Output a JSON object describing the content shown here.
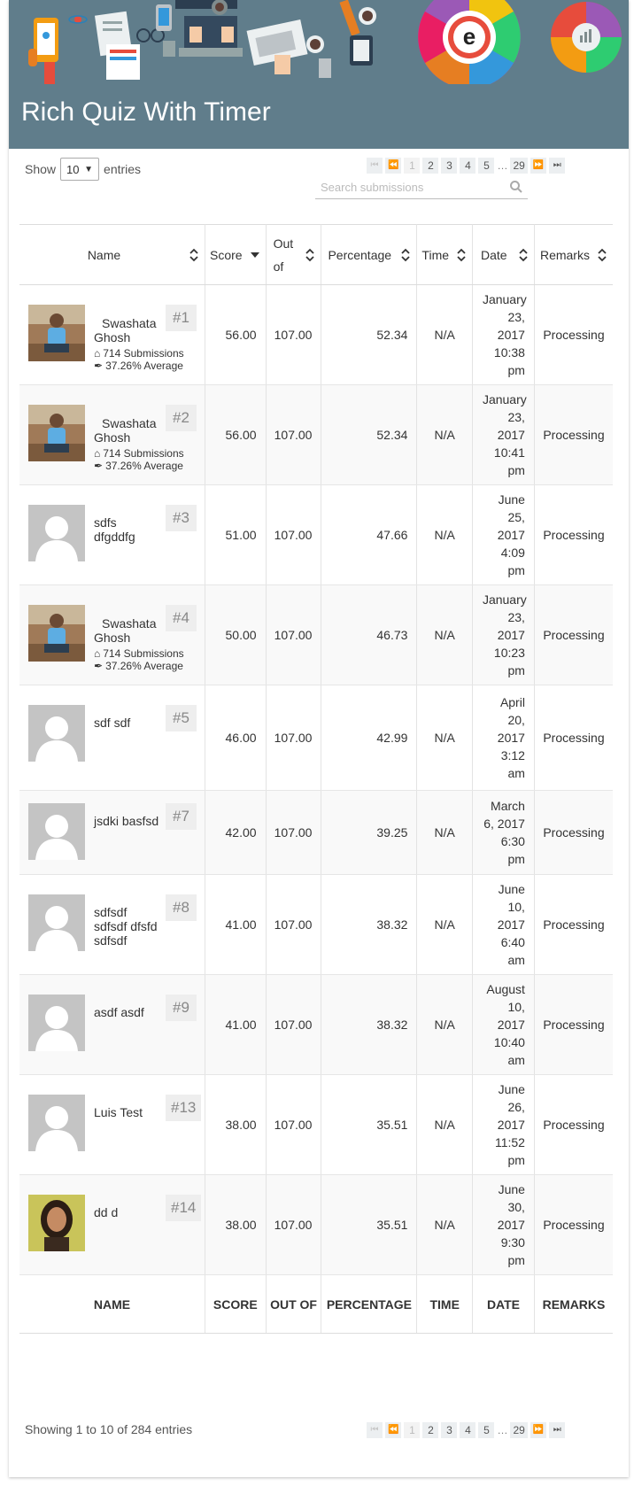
{
  "header": {
    "title": "Rich Quiz With Timer"
  },
  "length": {
    "prefix": "Show",
    "value": "10",
    "suffix": "entries"
  },
  "search": {
    "placeholder": "Search submissions"
  },
  "pagination": {
    "first": "⏮",
    "prev": "⏪",
    "pages": [
      "1",
      "2",
      "3",
      "4",
      "5"
    ],
    "ellipsis": "…",
    "last_page": "29",
    "next": "⏩",
    "last": "⏭",
    "current": "1"
  },
  "columns": {
    "name": "Name",
    "score": "Score",
    "out_of": "Out of",
    "percentage": "Percentage",
    "time": "Time",
    "date": "Date",
    "remarks": "Remarks"
  },
  "footer_columns": {
    "name": "NAME",
    "score": "SCORE",
    "out_of": "OUT OF",
    "percentage": "PERCENTAGE",
    "time": "TIME",
    "date": "DATE",
    "remarks": "REMARKS"
  },
  "rows": [
    {
      "avatar": "photo-man",
      "name": "Swashata Ghosh",
      "rank": "#1",
      "submissions": "714 Submissions",
      "average": "37.26% Average",
      "score": "56.00",
      "out_of": "107.00",
      "percentage": "52.34",
      "time": "N/A",
      "date": "January 23, 2017 10:38 pm",
      "remarks": "Processing"
    },
    {
      "avatar": "photo-man",
      "name": "Swashata Ghosh",
      "rank": "#2",
      "submissions": "714 Submissions",
      "average": "37.26% Average",
      "score": "56.00",
      "out_of": "107.00",
      "percentage": "52.34",
      "time": "N/A",
      "date": "January 23, 2017 10:41 pm",
      "remarks": "Processing"
    },
    {
      "avatar": "placeholder",
      "name": "sdfs dfgddfg",
      "rank": "#3",
      "score": "51.00",
      "out_of": "107.00",
      "percentage": "47.66",
      "time": "N/A",
      "date": "June 25, 2017 4:09 pm",
      "remarks": "Processing"
    },
    {
      "avatar": "photo-man",
      "name": "Swashata Ghosh",
      "rank": "#4",
      "submissions": "714 Submissions",
      "average": "37.26% Average",
      "score": "50.00",
      "out_of": "107.00",
      "percentage": "46.73",
      "time": "N/A",
      "date": "January 23, 2017 10:23 pm",
      "remarks": "Processing"
    },
    {
      "avatar": "placeholder",
      "name": "sdf sdf",
      "rank": "#5",
      "score": "46.00",
      "out_of": "107.00",
      "percentage": "42.99",
      "time": "N/A",
      "date": "April 20, 2017 3:12 am",
      "remarks": "Processing"
    },
    {
      "avatar": "placeholder",
      "name": "jsdki basfsd",
      "rank": "#7",
      "score": "42.00",
      "out_of": "107.00",
      "percentage": "39.25",
      "time": "N/A",
      "date": "March 6, 2017 6:30 pm",
      "remarks": "Processing"
    },
    {
      "avatar": "placeholder",
      "name": "sdfsdf sdfsdf dfsfd sdfsdf",
      "rank": "#8",
      "score": "41.00",
      "out_of": "107.00",
      "percentage": "38.32",
      "time": "N/A",
      "date": "June 10, 2017 6:40 am",
      "remarks": "Processing"
    },
    {
      "avatar": "placeholder",
      "name": "asdf asdf",
      "rank": "#9",
      "score": "41.00",
      "out_of": "107.00",
      "percentage": "38.32",
      "time": "N/A",
      "date": "August 10, 2017 10:40 am",
      "remarks": "Processing"
    },
    {
      "avatar": "placeholder",
      "name": "Luis Test",
      "rank": "#13",
      "score": "38.00",
      "out_of": "107.00",
      "percentage": "35.51",
      "time": "N/A",
      "date": "June 26, 2017 11:52 pm",
      "remarks": "Processing"
    },
    {
      "avatar": "photo-woman",
      "name": "dd d",
      "rank": "#14",
      "score": "38.00",
      "out_of": "107.00",
      "percentage": "35.51",
      "time": "N/A",
      "date": "June 30, 2017 9:30 pm",
      "remarks": "Processing"
    }
  ],
  "info": "Showing 1 to 10 of 284 entries",
  "colors": {
    "header_bg": "#607d8b",
    "pager_bg": "#eceff1",
    "rank_bg": "#eeeeee"
  }
}
